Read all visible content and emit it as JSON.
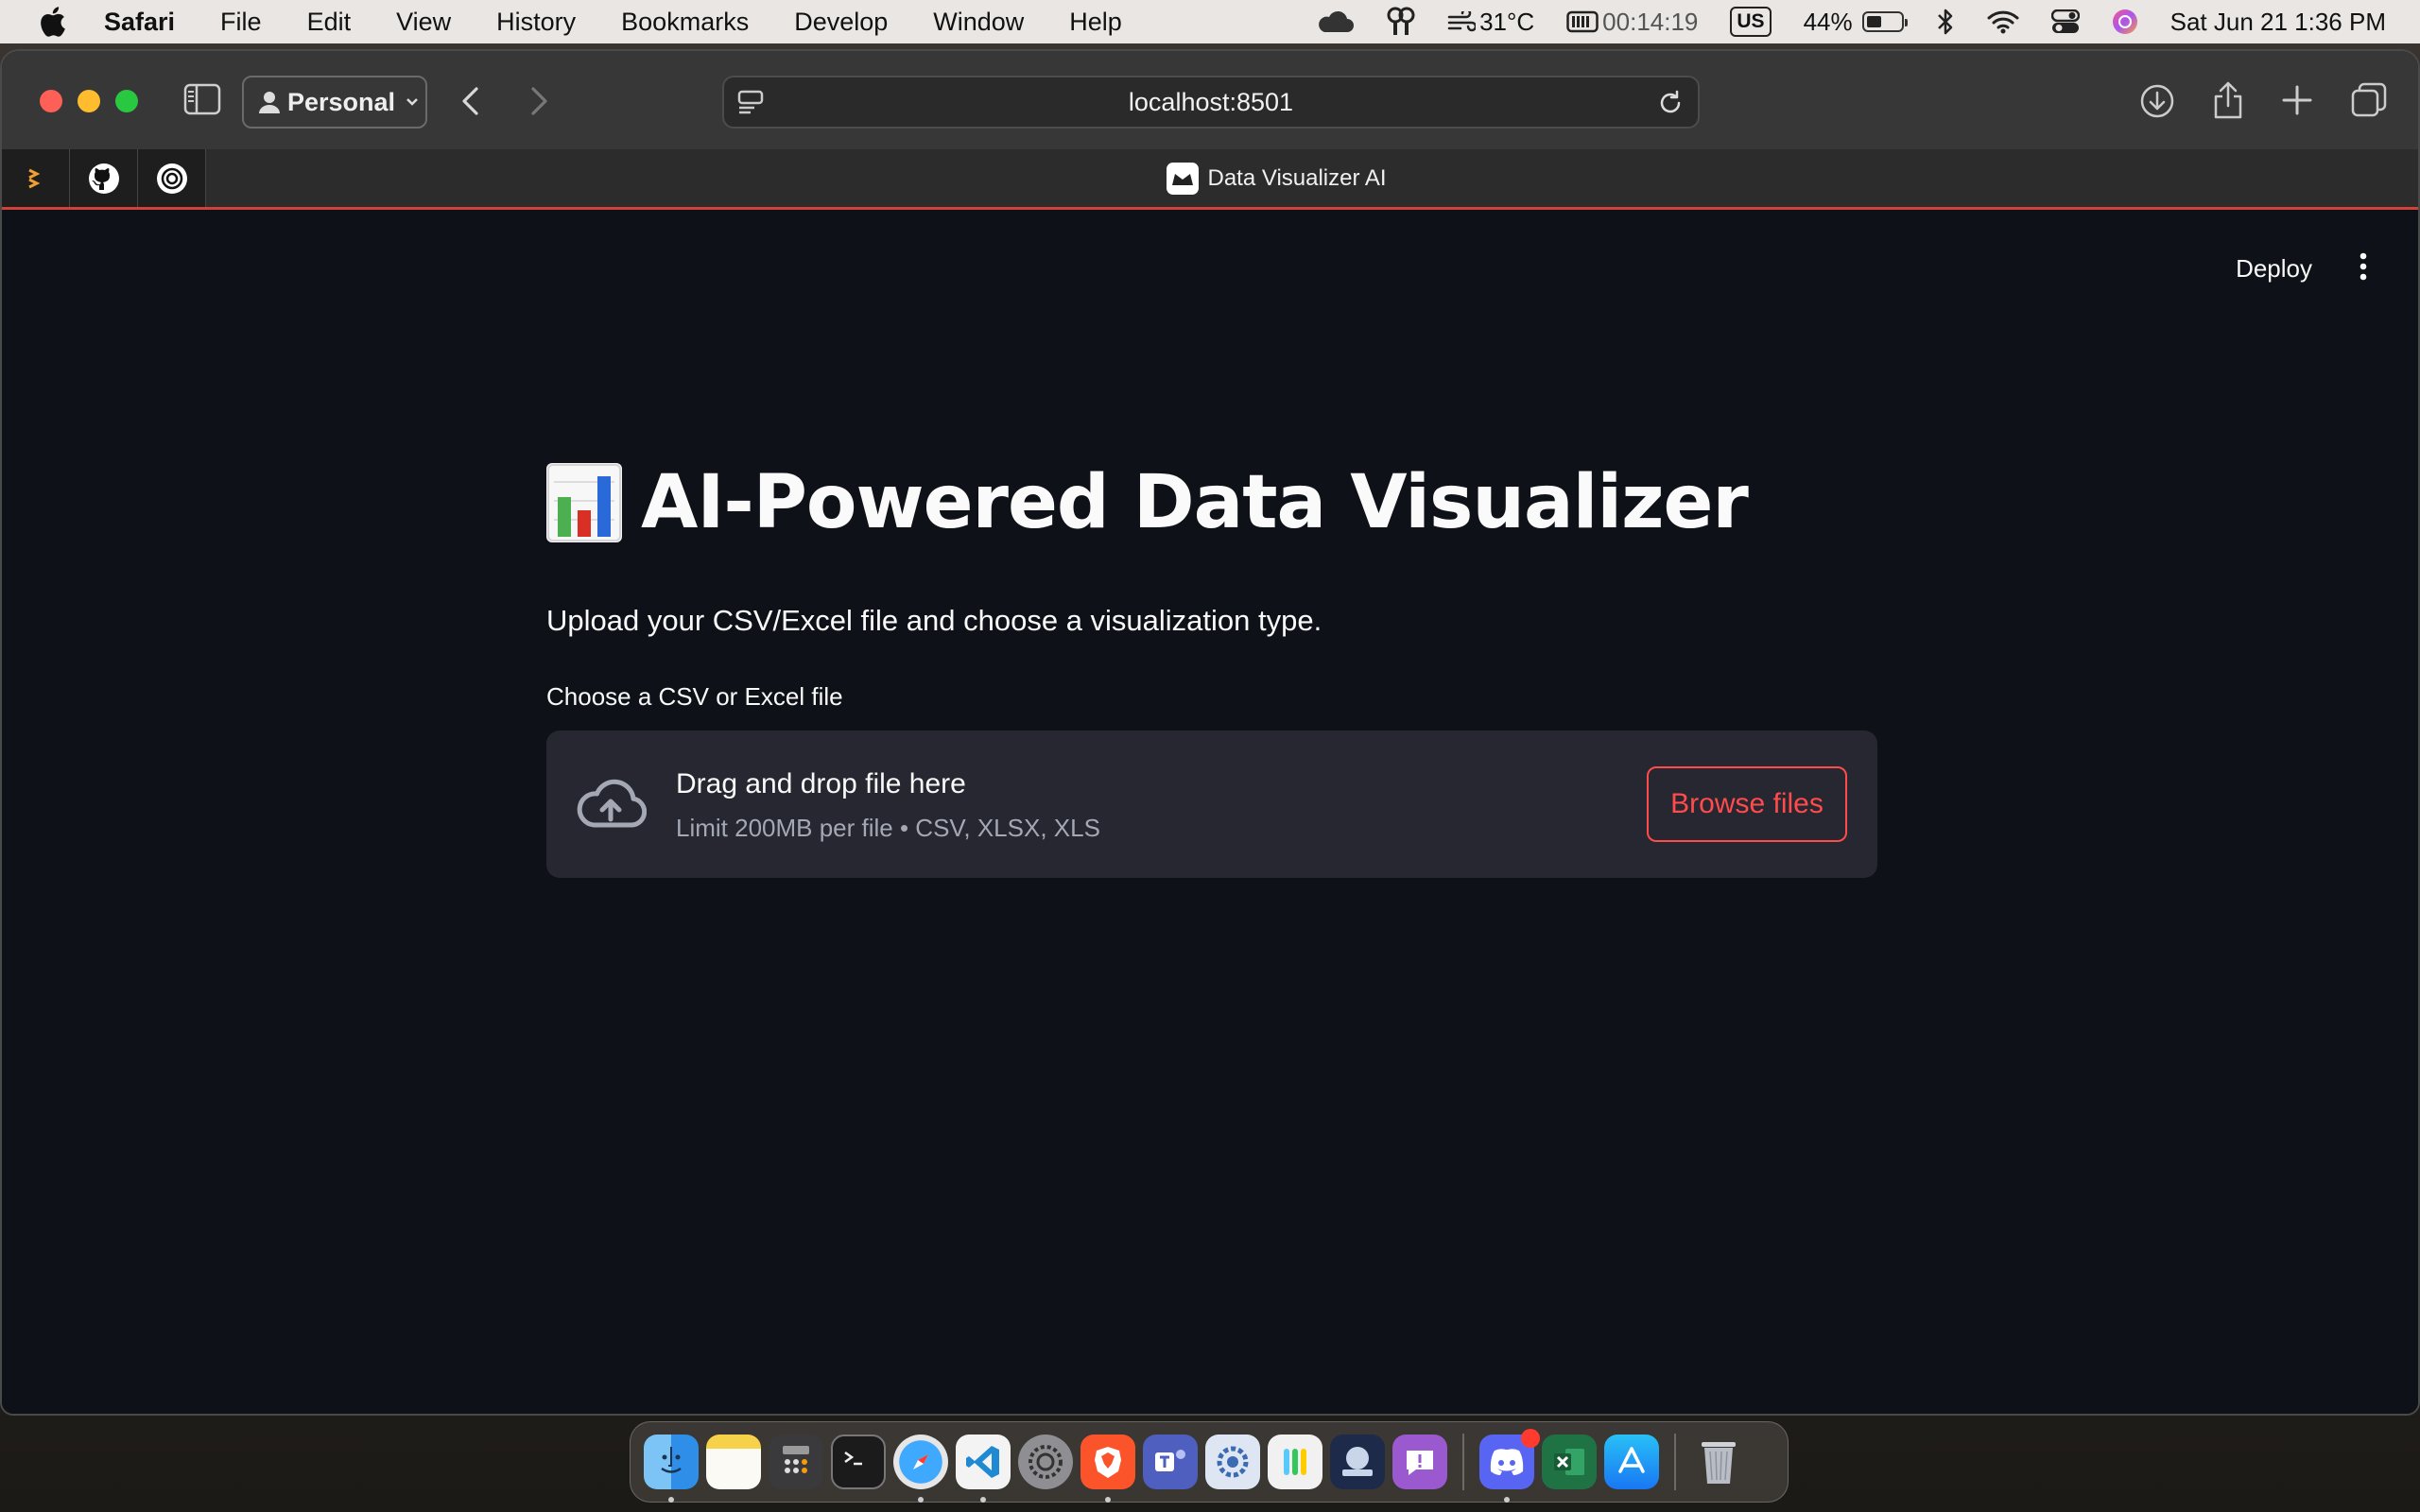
{
  "menubar": {
    "app_name": "Safari",
    "menus": [
      "File",
      "Edit",
      "View",
      "History",
      "Bookmarks",
      "Develop",
      "Window",
      "Help"
    ],
    "weather": "31°C",
    "timer": "00:14:19",
    "input_source": "US",
    "battery_percent": "44%",
    "battery_level": 0.44,
    "datetime": "Sat Jun 21  1:36 PM"
  },
  "browser": {
    "profile": "Personal",
    "url": "localhost:8501",
    "tab_title": "Data Visualizer AI",
    "accent_color": "#d0413a"
  },
  "app": {
    "deploy_label": "Deploy",
    "title": "AI-Powered Data Visualizer",
    "subtitle": "Upload your CSV/Excel file and choose a visualization type.",
    "uploader_label": "Choose a CSV or Excel file",
    "dropzone_main": "Drag and drop file here",
    "dropzone_sub": "Limit 200MB per file • CSV, XLSX, XLS",
    "browse_label": "Browse files",
    "primary_color": "#ff4b4b",
    "background_color": "#0e1117"
  },
  "dock": {
    "apps": [
      "Finder",
      "Notes",
      "Calculator",
      "Terminal",
      "Safari",
      "Visual Studio Code",
      "System Settings",
      "Brave Browser",
      "Microsoft Teams",
      "Utility",
      "Passwords",
      "Game",
      "Feedback Assistant",
      "Discord",
      "Microsoft Excel",
      "App Store",
      "Trash"
    ]
  }
}
